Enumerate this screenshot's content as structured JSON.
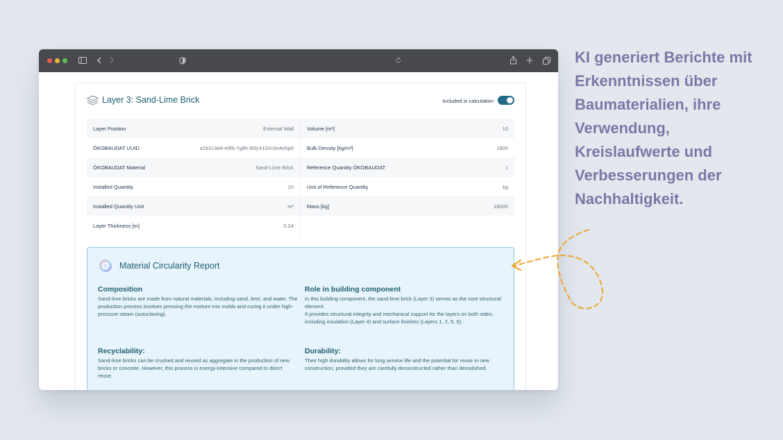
{
  "card": {
    "title": "Layer 3: Sand-Lime Brick",
    "toggle_label": "Included in calculation",
    "toggle_on": true
  },
  "properties_left": [
    {
      "key": "Layer Position",
      "value": "External Wall"
    },
    {
      "key": "ÖKOBAUDAT UUID",
      "value": "a1b2c3d4-e5f6-7g8h-9i0j-k1l2m3n4o5p6"
    },
    {
      "key": "ÖKOBAUDAT Material",
      "value": "Sand-Lime Brick"
    },
    {
      "key": "Installed Quantity",
      "value": "10"
    },
    {
      "key": "Installed Quantity Unit",
      "value": "m³"
    },
    {
      "key": "Layer Thickness [m]",
      "value": "0.24"
    }
  ],
  "properties_right": [
    {
      "key": "Volume [m³]",
      "value": "10"
    },
    {
      "key": "Bulk Density [kg/m³]",
      "value": "1800"
    },
    {
      "key": "Reference Quantity ÖKOBAUDAT",
      "value": "1"
    },
    {
      "key": "Unit of Reference Quantity",
      "value": "kg"
    },
    {
      "key": "Mass [kg]",
      "value": "18000"
    }
  ],
  "report": {
    "title": "Material Circularity Report",
    "sections": [
      {
        "heading": "Composition",
        "text": "Sand-lime bricks are made from natural materials, including sand, lime, and water. The production process involves pressing the mixture into molds and curing it under high-pressure steam (autoclaving)."
      },
      {
        "heading": "Role in building component",
        "text": "In this building component, the sand-lime brick (Layer 3) serves as the core structural element.\nIt provides structural integrity and mechanical support for the layers on both sides, including insulation (Layer 4) and surface finishes (Layers 1, 2, 5, 6)."
      },
      {
        "heading": "Recyclability:",
        "text": "Sand-lime bricks can be crushed and reused as aggregate in the production of new bricks or concrete. However, this process is energy-intensive compared to direct reuse."
      },
      {
        "heading": "Durability:",
        "text": "Their high durability allows for long service life and the potential for reuse in new construction, provided they are carefully deconstructed rather than demolished."
      }
    ]
  },
  "side_text": "KI generiert Berichte mit Erkenntnissen über Baumaterialien, ihre Verwendung, Kreislaufwerte und Verbesserungen der Nachhaltigkeit.",
  "colors": {
    "accent": "#1c5e73",
    "toggle": "#1f6a87",
    "report_bg": "#e8f4fb",
    "side_text": "#7a78a6",
    "doodle": "#f0a429"
  }
}
